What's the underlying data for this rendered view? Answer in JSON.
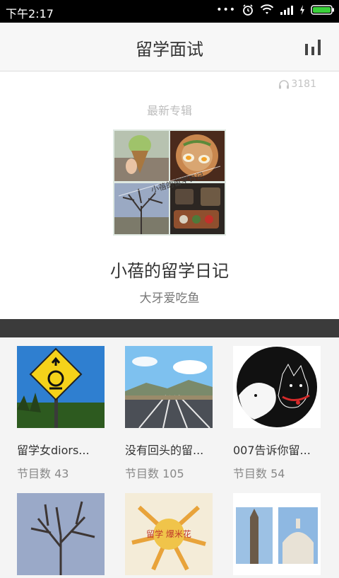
{
  "status_bar": {
    "time": "下午2:17"
  },
  "header": {
    "title": "留学面试"
  },
  "hero": {
    "listen_count": "3181",
    "section_label": "最新专辑",
    "album_title": "小蓓的留学日记",
    "album_author": "大牙爱吃鱼",
    "cover_caption": "小蓓的留学日记"
  },
  "grid": {
    "items": [
      {
        "name": "留学女diors...",
        "count_label": "节目数 43"
      },
      {
        "name": "没有回头的留...",
        "count_label": "节目数 105"
      },
      {
        "name": "007告诉你留...",
        "count_label": "节目数 54"
      }
    ],
    "second_row": [
      {
        "thumb_text": ""
      },
      {
        "thumb_text": "留学 爆米花"
      },
      {
        "thumb_text": ""
      }
    ]
  },
  "colors": {
    "header_bg": "#f7f7f7",
    "divider": "#3b3b3b",
    "battery": "#3ad13a"
  }
}
